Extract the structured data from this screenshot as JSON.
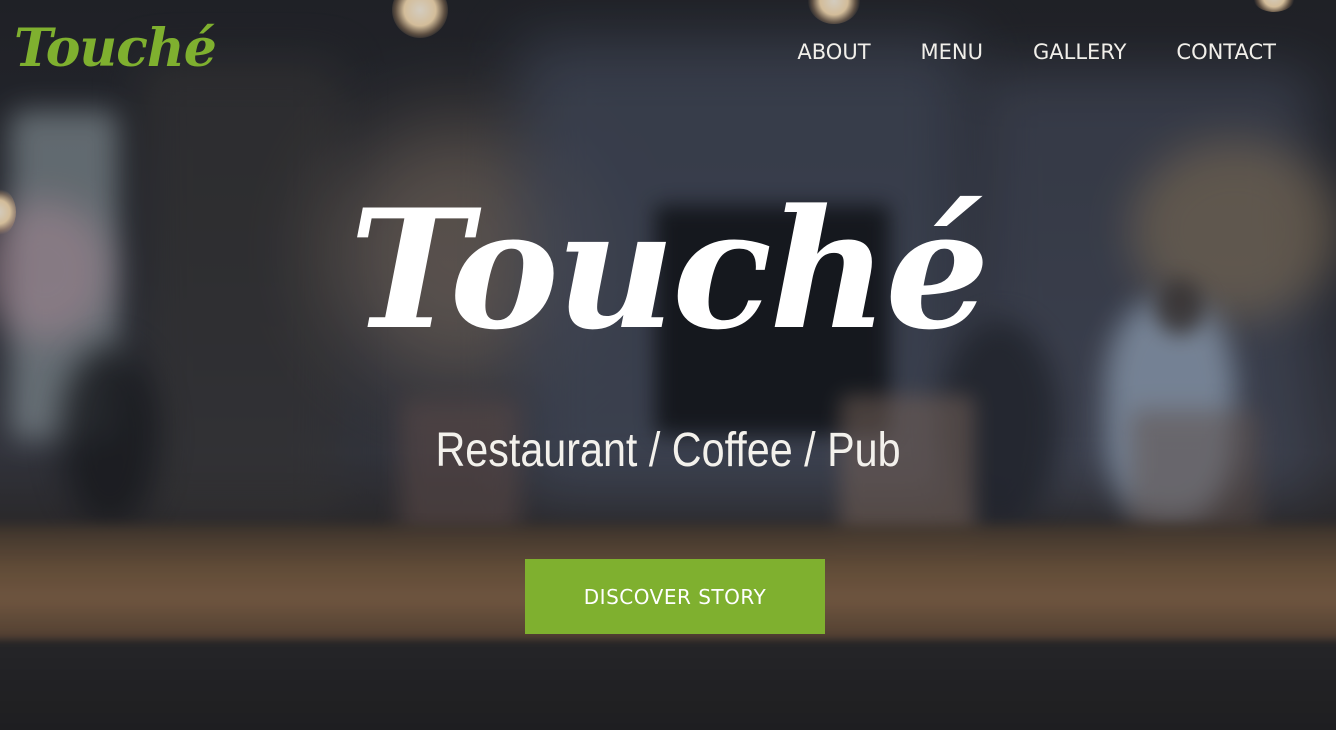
{
  "header": {
    "logo_text": "Touché",
    "nav": [
      {
        "label": "ABOUT"
      },
      {
        "label": "MENU"
      },
      {
        "label": "GALLERY"
      },
      {
        "label": "CONTACT"
      }
    ]
  },
  "hero": {
    "title": "Touché",
    "subtitle": "Restaurant / Coffee / Pub",
    "cta_label": "DISCOVER STORY",
    "background_image": "blurred-cafe-interior-photo"
  },
  "colors": {
    "accent": "#7fb02f",
    "text": "#ffffff"
  }
}
